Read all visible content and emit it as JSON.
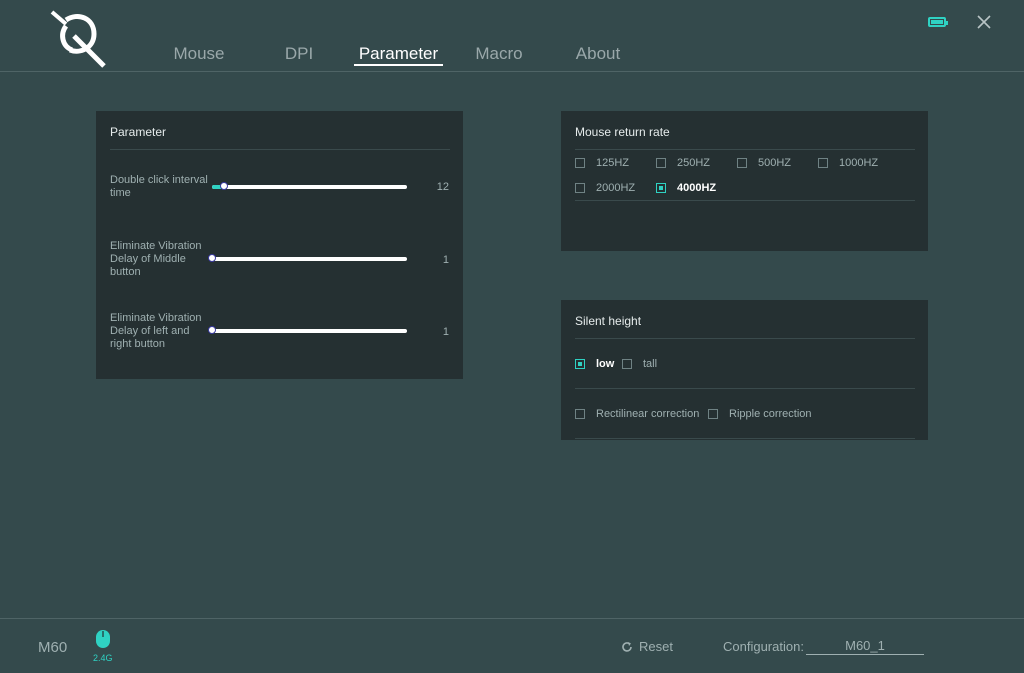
{
  "tabs": [
    {
      "label": "Mouse",
      "active": false
    },
    {
      "label": "DPI",
      "active": false
    },
    {
      "label": "Parameter",
      "active": true
    },
    {
      "label": "Macro",
      "active": false
    },
    {
      "label": "About",
      "active": false
    }
  ],
  "colors": {
    "accent": "#2fd2c3",
    "background": "#344a4c",
    "panel": "#253032"
  },
  "icons": {
    "logo": "brand-logo",
    "battery": "battery-icon",
    "close": "close-icon",
    "mouse": "mouse-icon",
    "reset": "refresh-icon"
  },
  "parameter": {
    "title": "Parameter",
    "sliders": [
      {
        "label": "Double click interval time",
        "value": "12",
        "fraction": 0.07
      },
      {
        "label": "Eliminate Vibration Delay of Middle button",
        "value": "1",
        "fraction": 0.0
      },
      {
        "label": "Eliminate Vibration Delay of left and right button",
        "value": "1",
        "fraction": 0.0
      }
    ]
  },
  "return_rate": {
    "title": "Mouse return rate",
    "options": [
      {
        "label": "125HZ",
        "checked": false
      },
      {
        "label": "250HZ",
        "checked": false
      },
      {
        "label": "500HZ",
        "checked": false
      },
      {
        "label": "1000HZ",
        "checked": false
      },
      {
        "label": "2000HZ",
        "checked": false
      },
      {
        "label": "4000HZ",
        "checked": true
      }
    ]
  },
  "silent": {
    "title": "Silent height",
    "height_options": [
      {
        "label": "low",
        "checked": true
      },
      {
        "label": "tall",
        "checked": false
      }
    ],
    "corrections": [
      {
        "label": "Rectilinear correction",
        "checked": false
      },
      {
        "label": "Ripple correction",
        "checked": false
      }
    ]
  },
  "footer": {
    "model": "M60",
    "wireless": "2.4G",
    "reset": "Reset",
    "config_label": "Configuration:",
    "config_value": "M60_1"
  }
}
